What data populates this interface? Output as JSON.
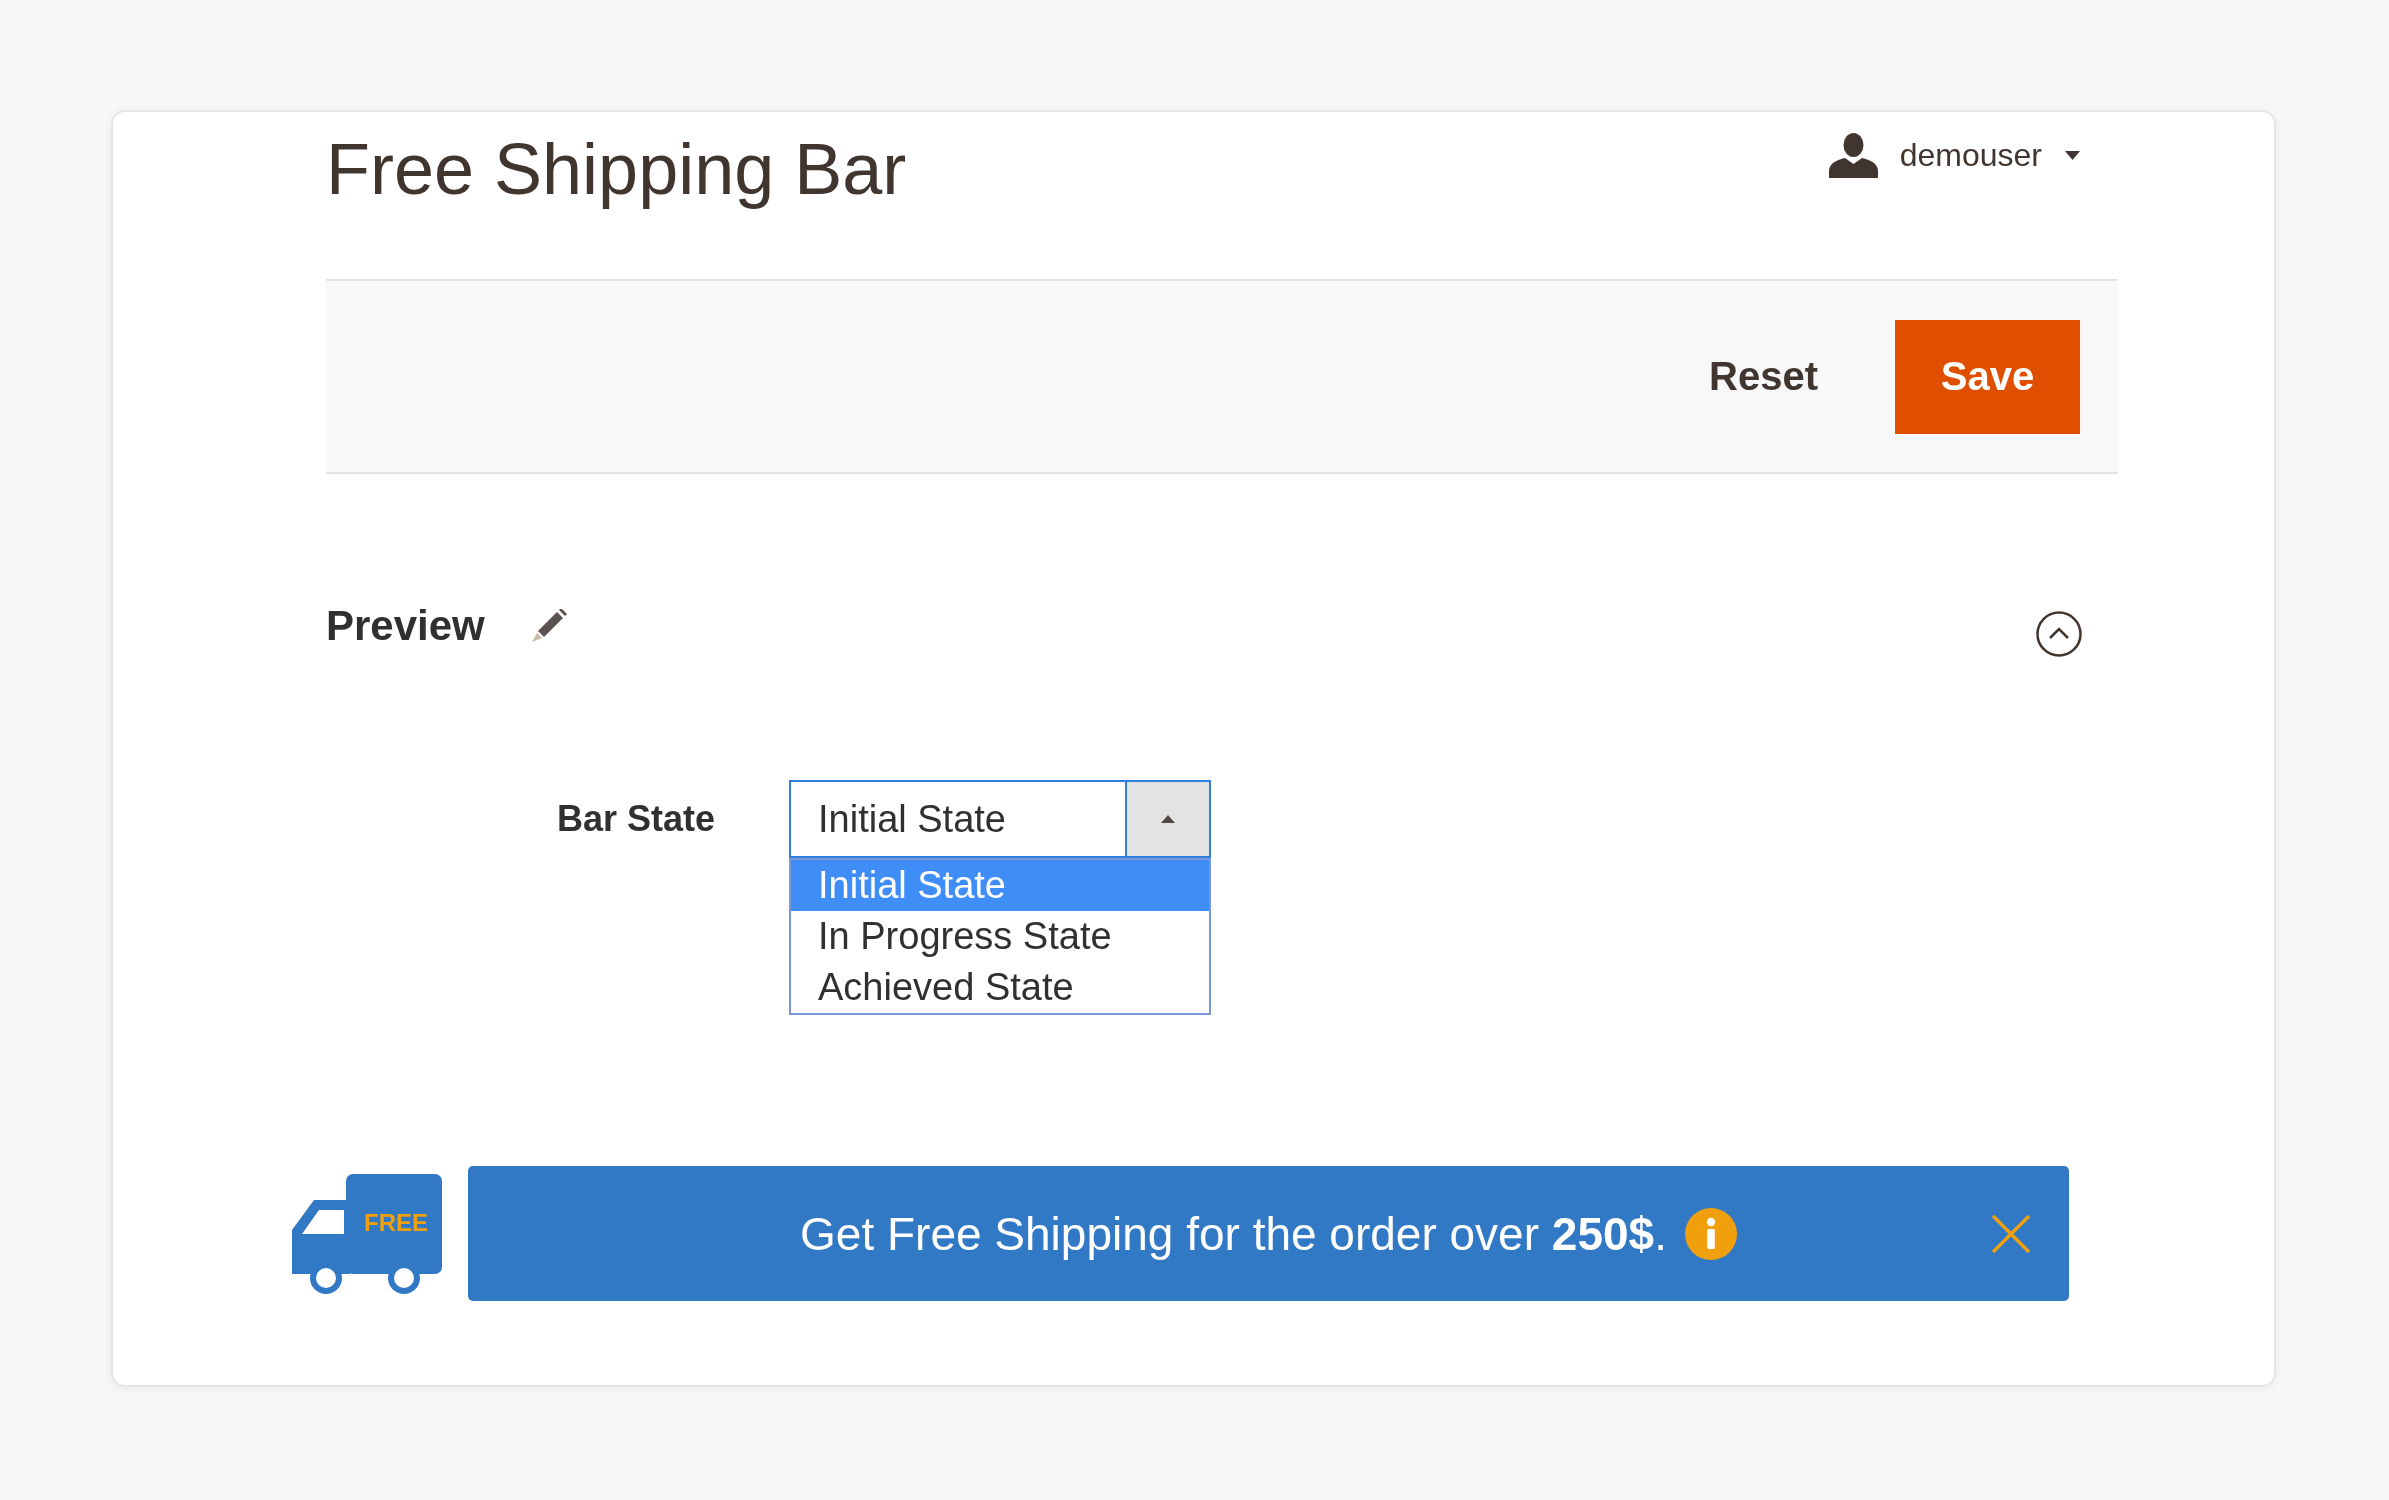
{
  "page": {
    "title": "Free Shipping Bar"
  },
  "user_menu": {
    "username": "demouser"
  },
  "actions": [
    {
      "kind": "reset",
      "label": "Reset"
    },
    {
      "kind": "save",
      "label": "Save"
    }
  ],
  "preview": {
    "title": "Preview",
    "expanded": true,
    "bar_state": {
      "label": "Bar State",
      "value": "Initial State",
      "open": true,
      "options": [
        {
          "label": "Initial State",
          "selected": true
        },
        {
          "label": "In Progress State",
          "selected": false
        },
        {
          "label": "Achieved State",
          "selected": false
        }
      ]
    },
    "bar": {
      "badge": "FREE",
      "message": "Get Free Shipping for the order over **250$**."
    }
  }
}
